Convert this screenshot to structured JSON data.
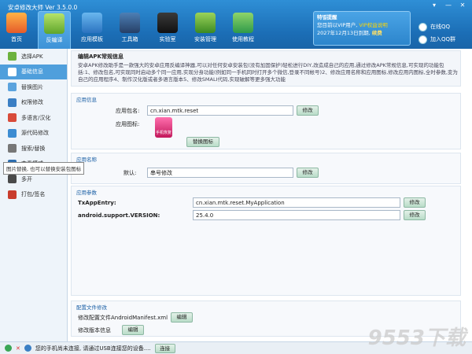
{
  "window": {
    "title": "安卓修改大师 Ver 3.5.0.0",
    "controls": [
      "▾",
      "—",
      "✕"
    ]
  },
  "toolbar": [
    {
      "label": "首页",
      "icon": "home-icon"
    },
    {
      "label": "反编译",
      "icon": "android-icon"
    },
    {
      "label": "应用模板",
      "icon": "star-icon"
    },
    {
      "label": "工具箱",
      "icon": "toolbox-icon"
    },
    {
      "label": "实验室",
      "icon": "flask-icon"
    },
    {
      "label": "安装管理",
      "icon": "install-icon"
    },
    {
      "label": "使用教程",
      "icon": "tutorial-icon"
    }
  ],
  "notice": {
    "heading": "特별提醒",
    "line1_prefix": "您目前以VIP用户, ",
    "line1_link": "VIP权益说明",
    "line2_prefix": "2027年12月13日到期, ",
    "line2_link": "续费"
  },
  "right_links": {
    "qq": "在线QQ",
    "group": "加入QQ群"
  },
  "sidebar": [
    {
      "label": "选择APK",
      "icon": "apk-icon"
    },
    {
      "label": "基础信息",
      "icon": "info-icon"
    },
    {
      "label": "替换图片",
      "icon": "image-icon"
    },
    {
      "label": "权限修改",
      "icon": "permission-icon"
    },
    {
      "label": "多语言/汉化",
      "icon": "language-icon"
    },
    {
      "label": "源代码修改",
      "icon": "code-icon"
    },
    {
      "label": "搜索/替换",
      "icon": "search-icon"
    },
    {
      "label": "查看模式",
      "icon": "view-icon"
    },
    {
      "label": "多开",
      "icon": "multi-icon"
    },
    {
      "label": "打包/签名",
      "icon": "sign-icon"
    }
  ],
  "tooltip": "图片替换, 也可以替换安装包图标",
  "header": {
    "title": "编辑APK常规信息",
    "description": "安卓APK修改助手是一款强大的安卓应用反编译神器,可以对任何安卓安装包(没有加固保护)轻松进行DIY,改造成自己的应用,通过修改APK常规信息,可实现的功能包括:1、修改包名,可实现同时启动多个同一应用,实现分身功能(例如同一手机同时打开多个微信,登录不同帐号)2、修改应用名称和应用图标,修改应用内图标,全时参数,变为自己的应用程序4、制作汉化版或者多语言版本5、修改SMALI代码,实现破解等更多强大功能"
  },
  "app_info": {
    "section_title": "应用信息",
    "package_label": "应用包名:",
    "package_value": "cn.xian.mtk.reset",
    "package_btn": "修改",
    "icon_label": "应用图标:",
    "icon_caption": "手机恢复",
    "icon_btn": "替换图标"
  },
  "app_name": {
    "section_title": "应用名称",
    "default_label": "默认:",
    "default_value": "串号修改",
    "btn": "修改"
  },
  "app_params": {
    "section_title": "应用参数",
    "rows": [
      {
        "label": "TxAppEntry:",
        "value": "cn.xian.mtk.reset.MyApplication",
        "btn": "修改"
      },
      {
        "label": "android.support.VERSION:",
        "value": "25.4.0",
        "btn": "修改"
      }
    ]
  },
  "config": {
    "section_title": "配置文件修改",
    "manifest_label": "修改配置文件AndroidManifest.xml",
    "manifest_btn": "编辑",
    "version_label": "修改版本信息",
    "version_btn": "编辑"
  },
  "status": {
    "text": "您的手机尚未连接, 请通过USB连接您的设备....",
    "btn": "连接"
  },
  "watermark": "9553下载"
}
